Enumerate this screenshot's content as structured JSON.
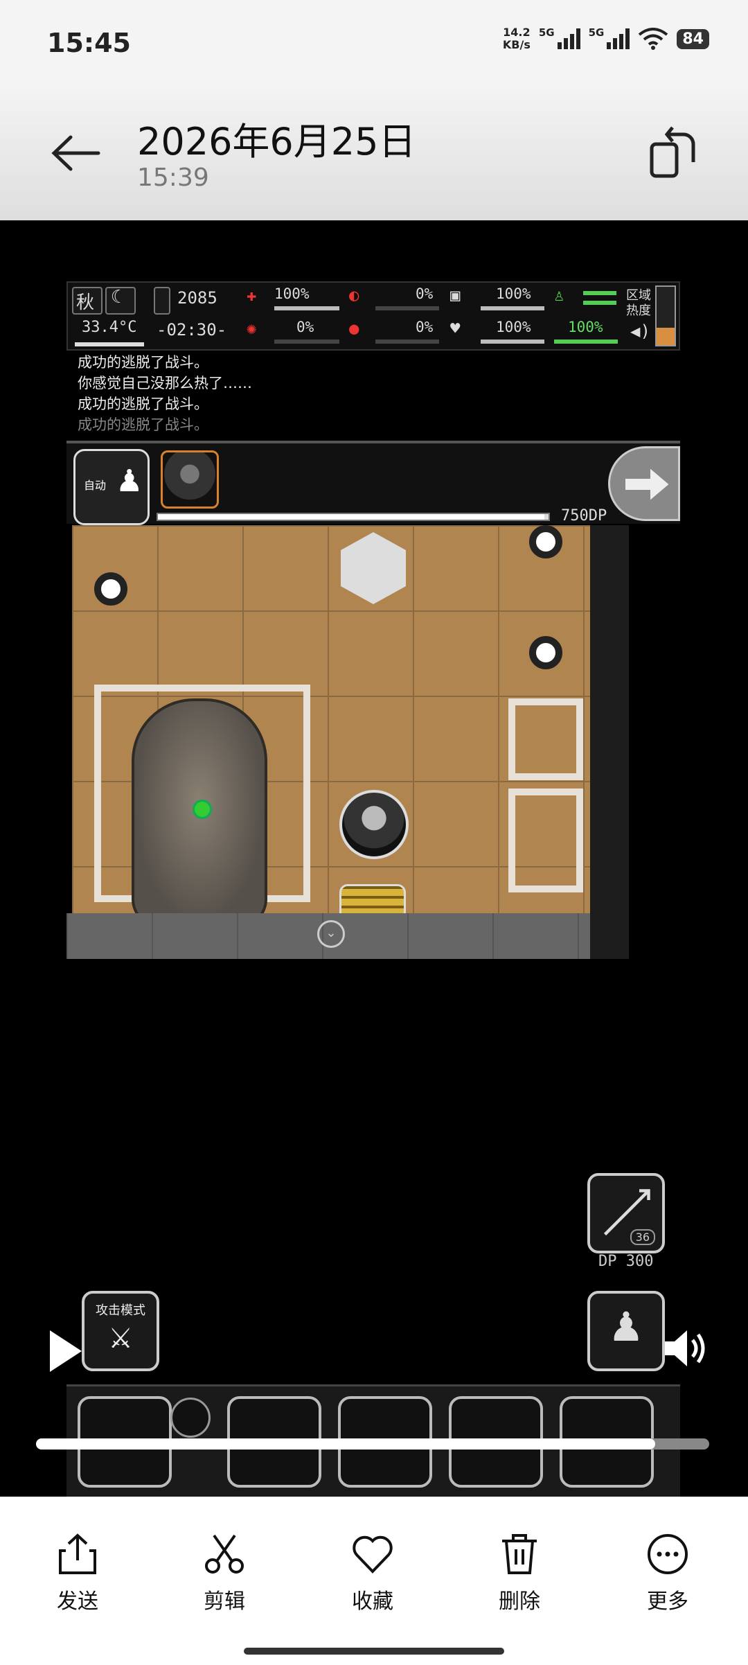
{
  "status_bar": {
    "time": "15:45",
    "net_speed_value": "14.2",
    "net_speed_unit": "KB/s",
    "net1": "5G",
    "net2": "5G",
    "battery": "84"
  },
  "header": {
    "title": "2026年6月25日",
    "subtitle": "15:39"
  },
  "game": {
    "hud": {
      "season": "秋",
      "temperature": "33.4°C",
      "day": "2085",
      "clock": "-02:30-",
      "health_pct": "100%",
      "stomach_pct": "0%",
      "hydration_pct": "100%",
      "brain_pct": "0%",
      "blood_pct": "0%",
      "heart_pct": "100%",
      "stamina_pct": "100%",
      "zone_label": "区域热度",
      "zone_heat_level": 0.3
    },
    "log": [
      "成功的逃脱了战斗。",
      "你感觉自己没那么热了……",
      "成功的逃脱了战斗。",
      "成功的逃脱了战斗。"
    ],
    "auto_label": "自动",
    "dp_value": "750DP",
    "dp_progress": 0.99,
    "skill_count": "36",
    "skill_dp": "DP 300",
    "attack_mode_label": "攻击模式",
    "video_progress": 0.92
  },
  "actions": [
    {
      "label": "发送",
      "icon": "share-icon"
    },
    {
      "label": "剪辑",
      "icon": "scissors-icon"
    },
    {
      "label": "收藏",
      "icon": "heart-icon"
    },
    {
      "label": "删除",
      "icon": "trash-icon"
    },
    {
      "label": "更多",
      "icon": "more-icon"
    }
  ]
}
